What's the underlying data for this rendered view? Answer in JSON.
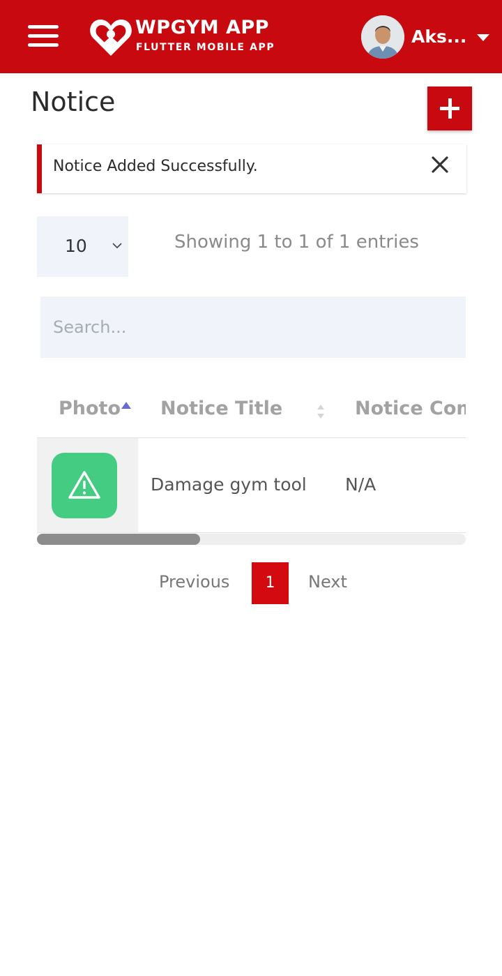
{
  "header": {
    "logo_title": "WPGYM APP",
    "logo_subtitle": "FLUTTER MOBILE APP",
    "user_name": "Aks...",
    "background_color": "#c8090f"
  },
  "page": {
    "title": "Notice",
    "add_button_icon": "plus-icon"
  },
  "alert": {
    "message": "Notice Added Successfully.",
    "close_icon": "close-icon",
    "accent_color": "#c8090f"
  },
  "table_controls": {
    "page_length": "10",
    "info": "Showing 1 to 1 of 1 entries",
    "search_placeholder": "Search..."
  },
  "table": {
    "columns": [
      "Photo",
      "Notice Title",
      "Notice Com"
    ],
    "rows": [
      {
        "photo_icon": "warning-icon",
        "title": "Damage gym tool",
        "comment": "N/A"
      }
    ],
    "horizontal_scroll_fraction": 0.38
  },
  "pagination": {
    "previous": "Previous",
    "current": "1",
    "next": "Next"
  }
}
